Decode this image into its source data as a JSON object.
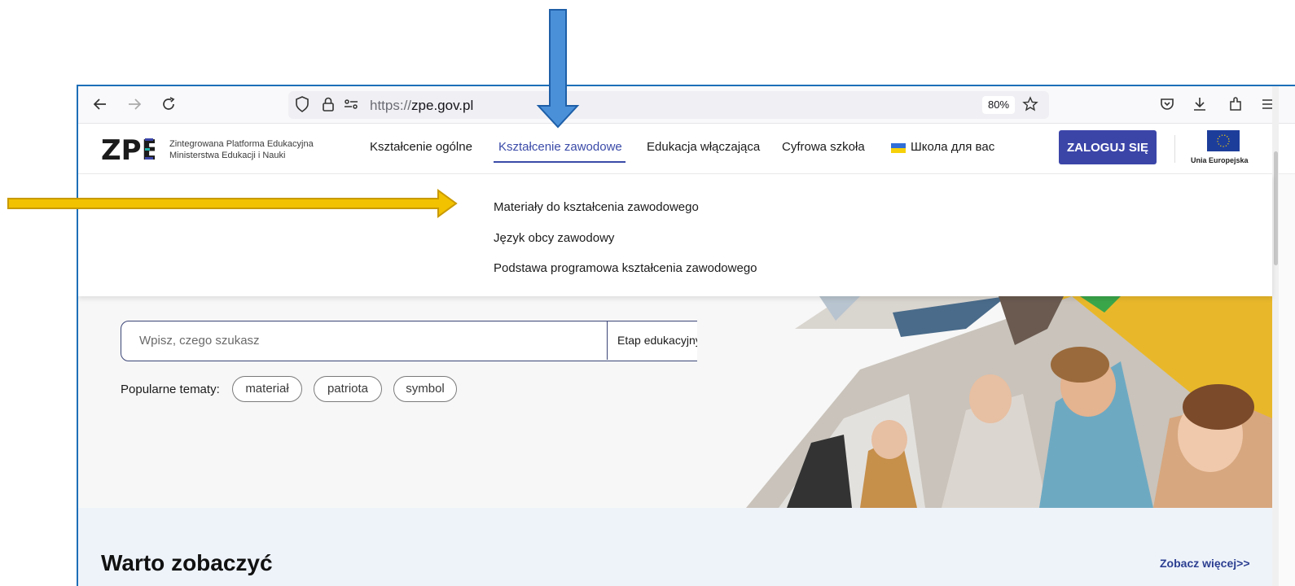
{
  "browser": {
    "url_protocol": "https://",
    "url_host": "zpe.gov.pl",
    "zoom": "80%"
  },
  "site": {
    "logo": "ZPE",
    "logo_line1": "Zintegrowana Platforma Edukacyjna",
    "logo_line2": "Ministerstwa Edukacji i Nauki",
    "nav": [
      "Kształcenie ogólne",
      "Kształcenie zawodowe",
      "Edukacja włączająca",
      "Cyfrowa szkoła",
      "Школа для вас"
    ],
    "login_label": "ZALOGUJ SIĘ",
    "eu_label": "Unia Europejska"
  },
  "dropdown": {
    "items": [
      "Materiały do kształcenia zawodowego",
      "Język obcy zawodowy",
      "Podstawa programowa kształcenia zawodowego"
    ]
  },
  "search": {
    "placeholder": "Wpisz, czego szukasz",
    "stage_label": "Etap edukacyjny"
  },
  "topics": {
    "label": "Popularne tematy:",
    "chips": [
      "materiał",
      "patriota",
      "symbol"
    ]
  },
  "section": {
    "title": "Warto zobaczyć",
    "more": "Zobacz więcej>>"
  },
  "colors": {
    "accent": "#3b45a8",
    "annotation_blue": "#4a90d9",
    "annotation_orange": "#f2c200"
  }
}
